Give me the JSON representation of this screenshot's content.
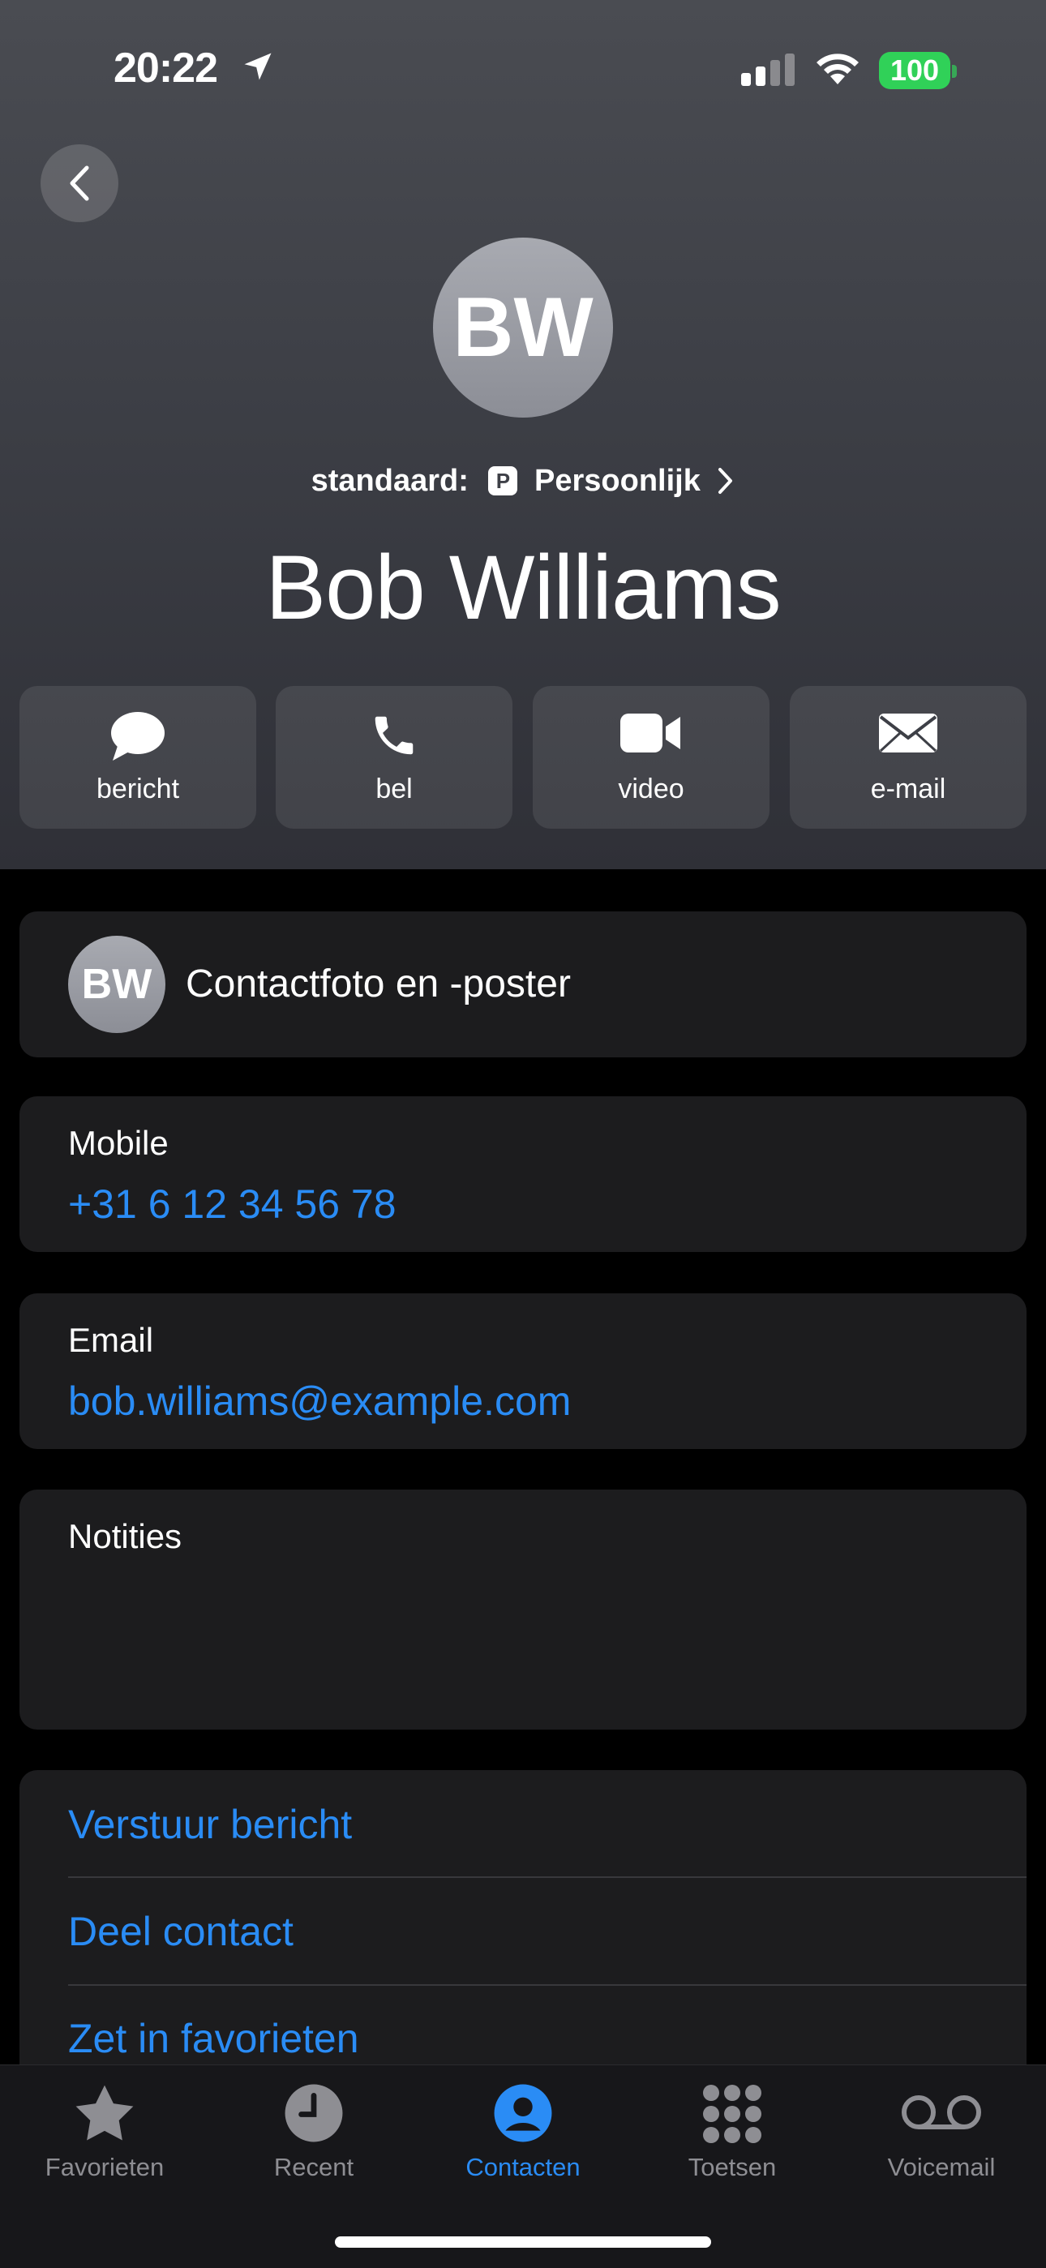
{
  "status_bar": {
    "time": "20:22",
    "battery": "100"
  },
  "contact": {
    "initials": "BW",
    "name": "Bob Williams",
    "standard_label": "standaard:",
    "badge_letter": "P",
    "account": "Persoonlijk"
  },
  "actions": [
    {
      "label": "bericht",
      "icon": "message-bubble-icon"
    },
    {
      "label": "bel",
      "icon": "phone-icon"
    },
    {
      "label": "video",
      "icon": "video-icon"
    },
    {
      "label": "e-mail",
      "icon": "mail-icon"
    }
  ],
  "photo_poster": {
    "label": "Contactfoto en -poster"
  },
  "phone": {
    "label": "Mobile",
    "value": "+31 6 12 34 56 78"
  },
  "email": {
    "label": "Email",
    "value": "bob.williams@example.com"
  },
  "notes": {
    "label": "Notities"
  },
  "links": [
    "Verstuur bericht",
    "Deel contact",
    "Zet in favorieten"
  ],
  "tabs": [
    {
      "label": "Favorieten",
      "icon": "star-icon"
    },
    {
      "label": "Recent",
      "icon": "clock-icon"
    },
    {
      "label": "Contacten",
      "icon": "person-icon",
      "active": true
    },
    {
      "label": "Toetsen",
      "icon": "keypad-icon"
    },
    {
      "label": "Voicemail",
      "icon": "voicemail-icon"
    }
  ],
  "colors": {
    "accent": "#2a8cf5",
    "battery": "#30d158",
    "card": "#1c1c1e"
  }
}
